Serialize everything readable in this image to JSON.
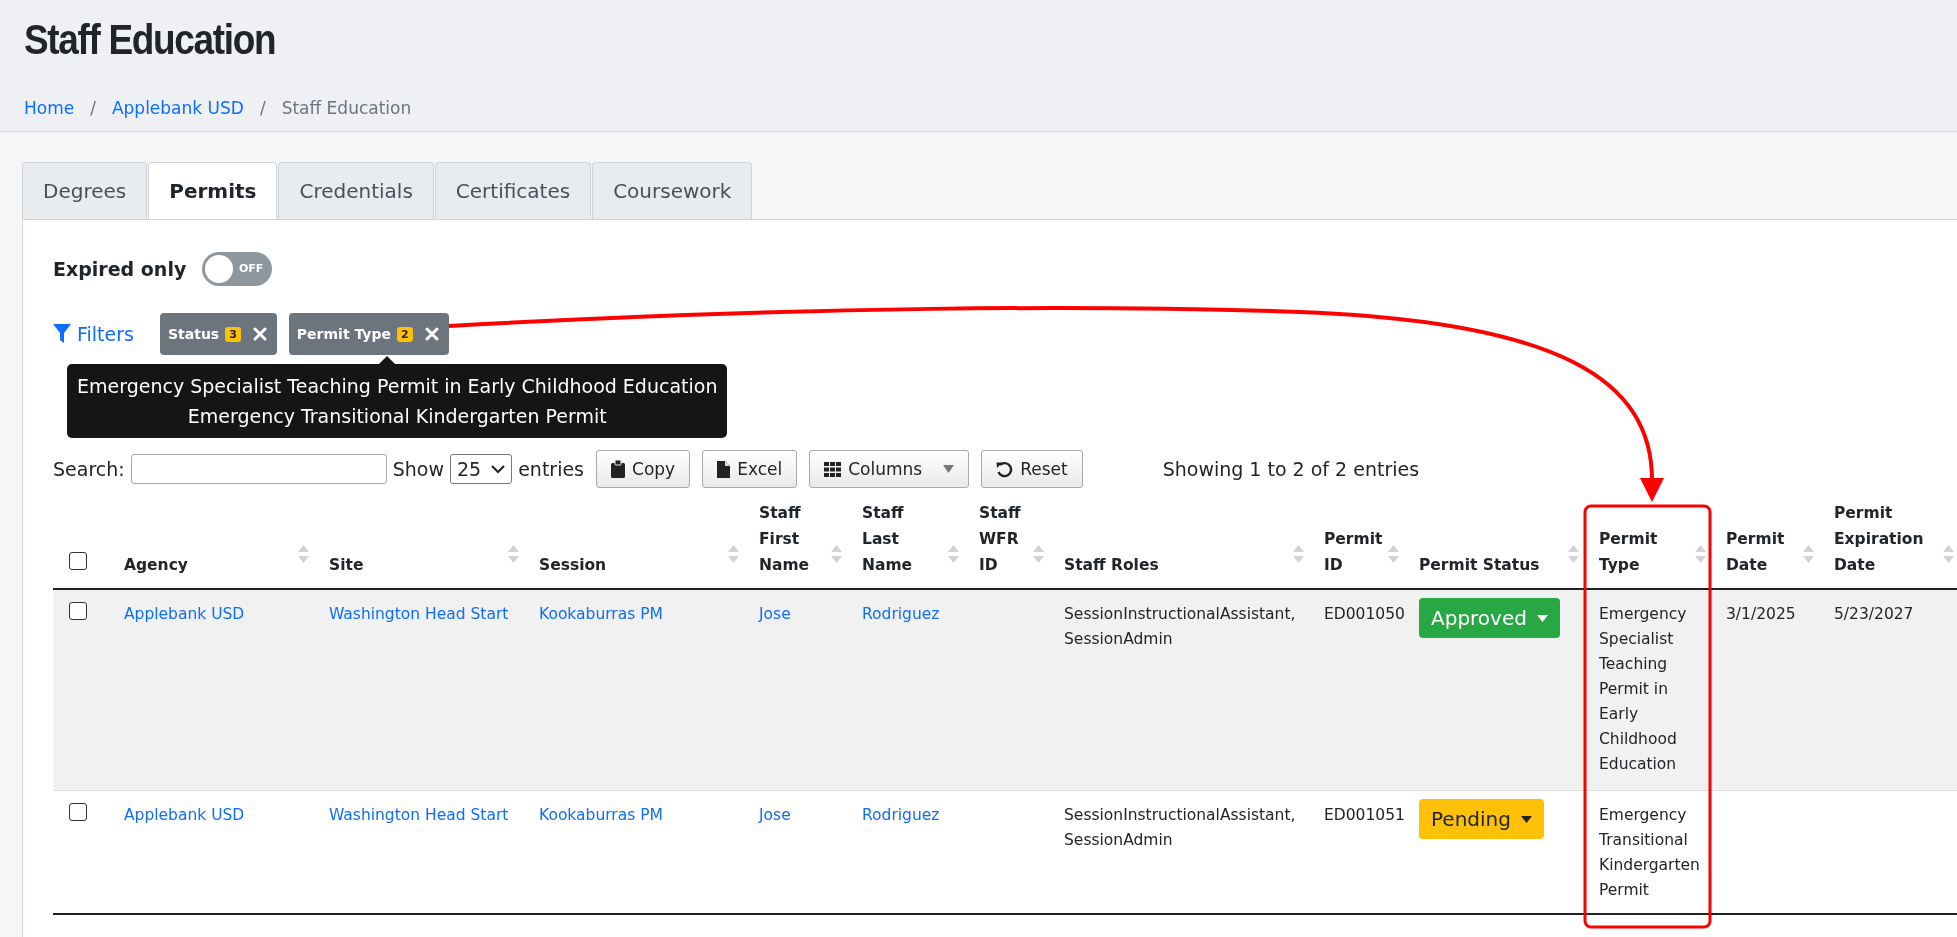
{
  "page": {
    "title": "Staff Education"
  },
  "breadcrumb": {
    "separator": "/",
    "items": [
      {
        "label": "Home",
        "link": true
      },
      {
        "label": "Applebank USD",
        "link": true
      },
      {
        "label": "Staff Education",
        "link": false
      }
    ]
  },
  "tabs": [
    {
      "label": "Degrees",
      "selected": false
    },
    {
      "label": "Permits",
      "selected": true
    },
    {
      "label": "Credentials",
      "selected": false
    },
    {
      "label": "Certificates",
      "selected": false
    },
    {
      "label": "Coursework",
      "selected": false
    }
  ],
  "expired_only": {
    "label": "Expired only",
    "on": false,
    "switch_text": "OFF"
  },
  "filters": {
    "label": "Filters",
    "chips": [
      {
        "label": "Status",
        "count": "3"
      },
      {
        "label": "Permit Type",
        "count": "2"
      }
    ]
  },
  "tooltip": {
    "lines": [
      "Emergency Specialist Teaching Permit in Early Childhood Education",
      "Emergency Transitional Kindergarten Permit"
    ]
  },
  "toolbar": {
    "search_label": "Search:",
    "show_label": "Show",
    "page_size": "25",
    "entries_label": "entries",
    "buttons": [
      {
        "label": "Copy",
        "kind": "copy"
      },
      {
        "label": "Excel",
        "kind": "excel"
      },
      {
        "label": "Columns",
        "kind": "columns"
      },
      {
        "label": "Reset",
        "kind": "reset"
      }
    ],
    "info": "Showing 1 to 2 of 2 entries"
  },
  "table": {
    "select_all_checked": false,
    "columns": [
      "Agency",
      "Site",
      "Session",
      "Staff First Name",
      "Staff Last Name",
      "Staff WFR ID",
      "Staff Roles",
      "Permit ID",
      "Permit Status",
      "Permit Type",
      "Permit Date",
      "Permit Expiration Date"
    ],
    "rows": [
      {
        "checked": false,
        "agency": "Applebank USD",
        "site": "Washington Head Start",
        "session": "Kookaburras PM",
        "first_name": "Jose",
        "last_name": "Rodriguez",
        "staff_roles": "SessionInstructionalAssistant, SessionAdmin",
        "permit_id": "ED001050",
        "status": {
          "label": "Approved",
          "kind": "approved"
        },
        "permit_type": "Emergency Specialist Teaching Permit in Early Childhood Education",
        "permit_date": "3/1/2025",
        "expiration_date": "5/23/2027"
      },
      {
        "checked": false,
        "agency": "Applebank USD",
        "site": "Washington Head Start",
        "session": "Kookaburras PM",
        "first_name": "Jose",
        "last_name": "Rodriguez",
        "staff_roles": "SessionInstructionalAssistant, SessionAdmin",
        "permit_id": "ED001051",
        "status": {
          "label": "Pending",
          "kind": "pending"
        },
        "permit_type": "Emergency Transitional Kindergarten Permit"
      }
    ]
  }
}
